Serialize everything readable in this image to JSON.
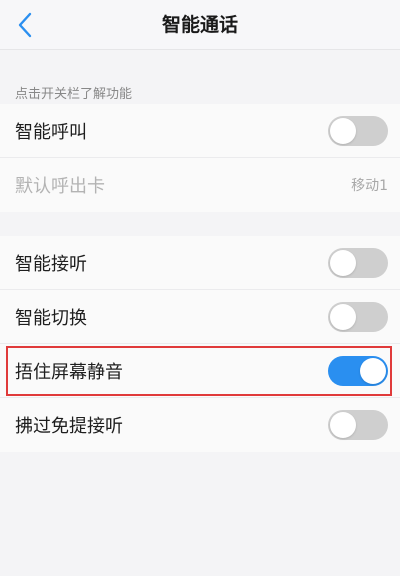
{
  "header": {
    "title": "智能通话"
  },
  "section_hint": "点击开关栏了解功能",
  "group1": [
    {
      "label": "智能呼叫",
      "type": "switch",
      "on": false
    },
    {
      "label": "默认呼出卡",
      "type": "value",
      "value": "移动1",
      "disabled": true
    }
  ],
  "group2": [
    {
      "label": "智能接听",
      "type": "switch",
      "on": false
    },
    {
      "label": "智能切换",
      "type": "switch",
      "on": false
    },
    {
      "label": "捂住屏幕静音",
      "type": "switch",
      "on": true
    },
    {
      "label": "拂过免提接听",
      "type": "switch",
      "on": false
    }
  ],
  "colors": {
    "accent": "#2a8ff0",
    "switch_off": "#cfcfcf",
    "highlight": "#e03a3a"
  },
  "icons": {
    "back": "chevron-left-icon"
  }
}
